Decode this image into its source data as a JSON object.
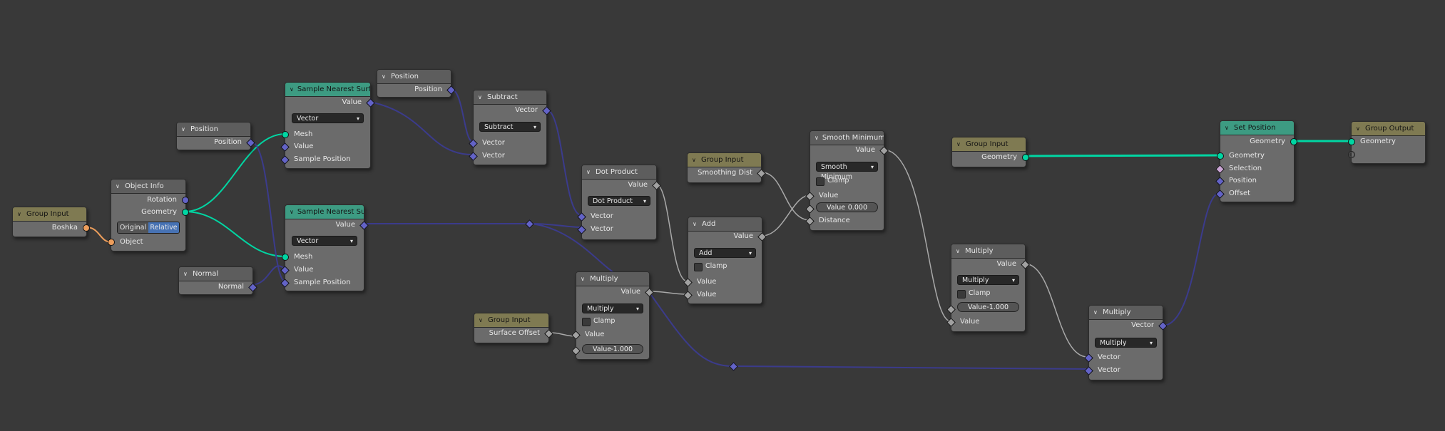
{
  "nodes": {
    "group_input_1": {
      "title": "Group Input",
      "out": "Boshka"
    },
    "object_info": {
      "title": "Object Info",
      "rotation": "Rotation",
      "geometry": "Geometry",
      "original": "Original",
      "relative": "Relative",
      "object": "Object"
    },
    "position_1": {
      "title": "Position",
      "out": "Position"
    },
    "normal": {
      "title": "Normal",
      "out": "Normal"
    },
    "sample_nearest_1": {
      "title": "Sample Nearest Surface",
      "value": "Value",
      "dropdown": "Vector",
      "mesh": "Mesh",
      "value_in": "Value",
      "sample_position": "Sample Position"
    },
    "sample_nearest_2": {
      "title": "Sample Nearest Surface",
      "value": "Value",
      "dropdown": "Vector",
      "mesh": "Mesh",
      "value_in": "Value",
      "sample_position": "Sample Position"
    },
    "position_2": {
      "title": "Position",
      "out": "Position"
    },
    "subtract": {
      "title": "Subtract",
      "out": "Vector",
      "dropdown": "Subtract",
      "in1": "Vector",
      "in2": "Vector"
    },
    "dot_product": {
      "title": "Dot Product",
      "out": "Value",
      "dropdown": "Dot Product",
      "in1": "Vector",
      "in2": "Vector"
    },
    "group_input_surface": {
      "title": "Group Input",
      "out": "Surface Offset"
    },
    "multiply_1": {
      "title": "Multiply",
      "out": "Value",
      "dropdown": "Multiply",
      "clamp": "Clamp",
      "in1": "Value",
      "field_label": "Value",
      "field_value": "-1.000"
    },
    "group_input_smooth": {
      "title": "Group Input",
      "out": "Smoothing Dist"
    },
    "add": {
      "title": "Add",
      "out": "Value",
      "dropdown": "Add",
      "clamp": "Clamp",
      "in1": "Value",
      "in2": "Value"
    },
    "smooth_min": {
      "title": "Smooth Minimum",
      "out": "Value",
      "dropdown": "Smooth Minimum",
      "clamp": "Clamp",
      "in1": "Value",
      "field_label": "Value",
      "field_value": "0.000",
      "distance": "Distance"
    },
    "group_input_geo": {
      "title": "Group Input",
      "out": "Geometry"
    },
    "multiply_2": {
      "title": "Multiply",
      "out": "Value",
      "dropdown": "Multiply",
      "clamp": "Clamp",
      "field_label": "Value",
      "field_value": "-1.000",
      "in2": "Value"
    },
    "multiply_vec": {
      "title": "Multiply",
      "out": "Vector",
      "dropdown": "Multiply",
      "in1": "Vector",
      "in2": "Vector"
    },
    "set_position": {
      "title": "Set Position",
      "out": "Geometry",
      "geometry": "Geometry",
      "selection": "Selection",
      "position": "Position",
      "offset": "Offset"
    },
    "group_output": {
      "title": "Group Output",
      "geometry": "Geometry"
    }
  },
  "colors": {
    "geometry": "#00d6a3",
    "vector": "#6363c7",
    "value": "#a1a1a1",
    "object": "#ed9e5c",
    "background": "#393939",
    "node_body": "#6b6b6b",
    "input_header": "#7f7a52",
    "geometry_header": "#3d9b82",
    "math_header": "#5d5d5d"
  }
}
